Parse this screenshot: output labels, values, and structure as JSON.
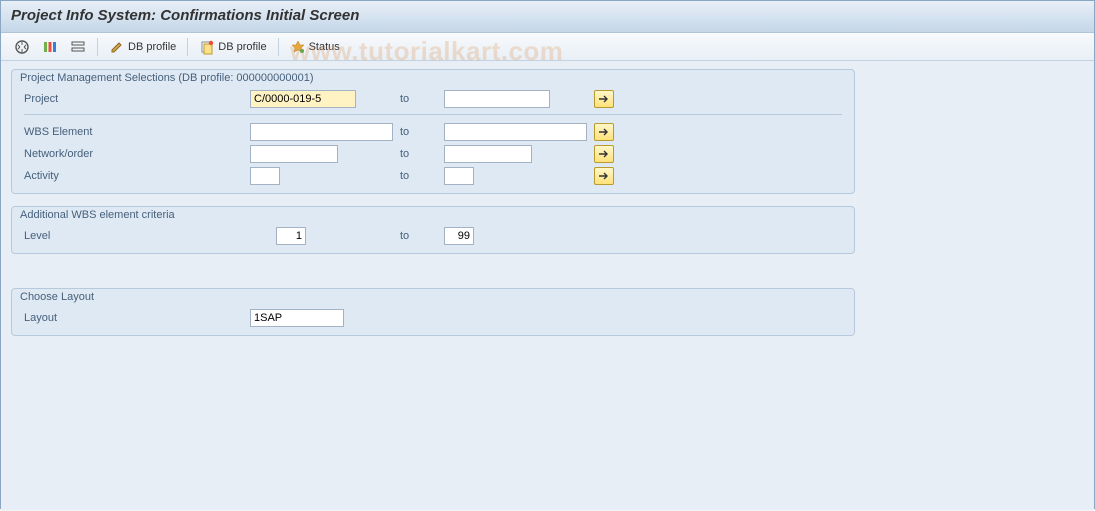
{
  "title": "Project Info System: Confirmations Initial Screen",
  "watermark": "www.tutorialkart.com",
  "toolbar": {
    "db_profile_edit": "DB profile",
    "db_profile_select": "DB profile",
    "status": "Status"
  },
  "group_pm": {
    "title": "Project Management Selections (DB profile: 000000000001)",
    "project": {
      "label": "Project",
      "from": "C/0000-019-5",
      "to": ""
    },
    "wbs": {
      "label": "WBS Element",
      "from": "",
      "to": ""
    },
    "network": {
      "label": "Network/order",
      "from": "",
      "to": ""
    },
    "activity": {
      "label": "Activity",
      "from": "",
      "to": ""
    },
    "to_label": "to"
  },
  "group_add": {
    "title": "Additional WBS element criteria",
    "level": {
      "label": "Level",
      "from": "1",
      "to": "99"
    },
    "to_label": "to"
  },
  "group_layout": {
    "title": "Choose Layout",
    "layout": {
      "label": "Layout",
      "value": "1SAP"
    }
  }
}
